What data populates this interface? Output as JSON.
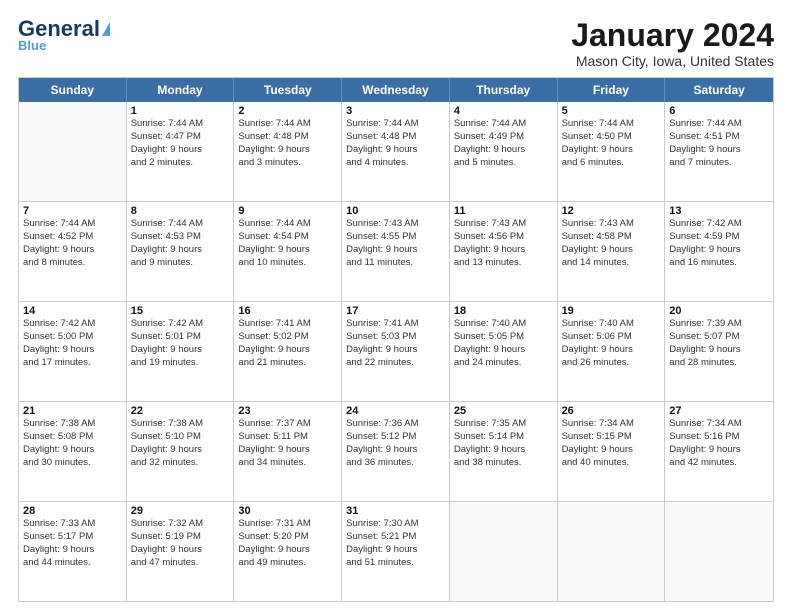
{
  "header": {
    "logo_general": "General",
    "logo_blue": "Blue",
    "title": "January 2024",
    "subtitle": "Mason City, Iowa, United States"
  },
  "calendar": {
    "days_of_week": [
      "Sunday",
      "Monday",
      "Tuesday",
      "Wednesday",
      "Thursday",
      "Friday",
      "Saturday"
    ],
    "weeks": [
      [
        {
          "day": "",
          "empty": true
        },
        {
          "day": "1",
          "lines": [
            "Sunrise: 7:44 AM",
            "Sunset: 4:47 PM",
            "Daylight: 9 hours",
            "and 2 minutes."
          ]
        },
        {
          "day": "2",
          "lines": [
            "Sunrise: 7:44 AM",
            "Sunset: 4:48 PM",
            "Daylight: 9 hours",
            "and 3 minutes."
          ]
        },
        {
          "day": "3",
          "lines": [
            "Sunrise: 7:44 AM",
            "Sunset: 4:48 PM",
            "Daylight: 9 hours",
            "and 4 minutes."
          ]
        },
        {
          "day": "4",
          "lines": [
            "Sunrise: 7:44 AM",
            "Sunset: 4:49 PM",
            "Daylight: 9 hours",
            "and 5 minutes."
          ]
        },
        {
          "day": "5",
          "lines": [
            "Sunrise: 7:44 AM",
            "Sunset: 4:50 PM",
            "Daylight: 9 hours",
            "and 6 minutes."
          ]
        },
        {
          "day": "6",
          "lines": [
            "Sunrise: 7:44 AM",
            "Sunset: 4:51 PM",
            "Daylight: 9 hours",
            "and 7 minutes."
          ]
        }
      ],
      [
        {
          "day": "7",
          "lines": [
            "Sunrise: 7:44 AM",
            "Sunset: 4:52 PM",
            "Daylight: 9 hours",
            "and 8 minutes."
          ]
        },
        {
          "day": "8",
          "lines": [
            "Sunrise: 7:44 AM",
            "Sunset: 4:53 PM",
            "Daylight: 9 hours",
            "and 9 minutes."
          ]
        },
        {
          "day": "9",
          "lines": [
            "Sunrise: 7:44 AM",
            "Sunset: 4:54 PM",
            "Daylight: 9 hours",
            "and 10 minutes."
          ]
        },
        {
          "day": "10",
          "lines": [
            "Sunrise: 7:43 AM",
            "Sunset: 4:55 PM",
            "Daylight: 9 hours",
            "and 11 minutes."
          ]
        },
        {
          "day": "11",
          "lines": [
            "Sunrise: 7:43 AM",
            "Sunset: 4:56 PM",
            "Daylight: 9 hours",
            "and 13 minutes."
          ]
        },
        {
          "day": "12",
          "lines": [
            "Sunrise: 7:43 AM",
            "Sunset: 4:58 PM",
            "Daylight: 9 hours",
            "and 14 minutes."
          ]
        },
        {
          "day": "13",
          "lines": [
            "Sunrise: 7:42 AM",
            "Sunset: 4:59 PM",
            "Daylight: 9 hours",
            "and 16 minutes."
          ]
        }
      ],
      [
        {
          "day": "14",
          "lines": [
            "Sunrise: 7:42 AM",
            "Sunset: 5:00 PM",
            "Daylight: 9 hours",
            "and 17 minutes."
          ]
        },
        {
          "day": "15",
          "lines": [
            "Sunrise: 7:42 AM",
            "Sunset: 5:01 PM",
            "Daylight: 9 hours",
            "and 19 minutes."
          ]
        },
        {
          "day": "16",
          "lines": [
            "Sunrise: 7:41 AM",
            "Sunset: 5:02 PM",
            "Daylight: 9 hours",
            "and 21 minutes."
          ]
        },
        {
          "day": "17",
          "lines": [
            "Sunrise: 7:41 AM",
            "Sunset: 5:03 PM",
            "Daylight: 9 hours",
            "and 22 minutes."
          ]
        },
        {
          "day": "18",
          "lines": [
            "Sunrise: 7:40 AM",
            "Sunset: 5:05 PM",
            "Daylight: 9 hours",
            "and 24 minutes."
          ]
        },
        {
          "day": "19",
          "lines": [
            "Sunrise: 7:40 AM",
            "Sunset: 5:06 PM",
            "Daylight: 9 hours",
            "and 26 minutes."
          ]
        },
        {
          "day": "20",
          "lines": [
            "Sunrise: 7:39 AM",
            "Sunset: 5:07 PM",
            "Daylight: 9 hours",
            "and 28 minutes."
          ]
        }
      ],
      [
        {
          "day": "21",
          "lines": [
            "Sunrise: 7:38 AM",
            "Sunset: 5:08 PM",
            "Daylight: 9 hours",
            "and 30 minutes."
          ]
        },
        {
          "day": "22",
          "lines": [
            "Sunrise: 7:38 AM",
            "Sunset: 5:10 PM",
            "Daylight: 9 hours",
            "and 32 minutes."
          ]
        },
        {
          "day": "23",
          "lines": [
            "Sunrise: 7:37 AM",
            "Sunset: 5:11 PM",
            "Daylight: 9 hours",
            "and 34 minutes."
          ]
        },
        {
          "day": "24",
          "lines": [
            "Sunrise: 7:36 AM",
            "Sunset: 5:12 PM",
            "Daylight: 9 hours",
            "and 36 minutes."
          ]
        },
        {
          "day": "25",
          "lines": [
            "Sunrise: 7:35 AM",
            "Sunset: 5:14 PM",
            "Daylight: 9 hours",
            "and 38 minutes."
          ]
        },
        {
          "day": "26",
          "lines": [
            "Sunrise: 7:34 AM",
            "Sunset: 5:15 PM",
            "Daylight: 9 hours",
            "and 40 minutes."
          ]
        },
        {
          "day": "27",
          "lines": [
            "Sunrise: 7:34 AM",
            "Sunset: 5:16 PM",
            "Daylight: 9 hours",
            "and 42 minutes."
          ]
        }
      ],
      [
        {
          "day": "28",
          "lines": [
            "Sunrise: 7:33 AM",
            "Sunset: 5:17 PM",
            "Daylight: 9 hours",
            "and 44 minutes."
          ]
        },
        {
          "day": "29",
          "lines": [
            "Sunrise: 7:32 AM",
            "Sunset: 5:19 PM",
            "Daylight: 9 hours",
            "and 47 minutes."
          ]
        },
        {
          "day": "30",
          "lines": [
            "Sunrise: 7:31 AM",
            "Sunset: 5:20 PM",
            "Daylight: 9 hours",
            "and 49 minutes."
          ]
        },
        {
          "day": "31",
          "lines": [
            "Sunrise: 7:30 AM",
            "Sunset: 5:21 PM",
            "Daylight: 9 hours",
            "and 51 minutes."
          ]
        },
        {
          "day": "",
          "empty": true
        },
        {
          "day": "",
          "empty": true
        },
        {
          "day": "",
          "empty": true
        }
      ]
    ]
  }
}
